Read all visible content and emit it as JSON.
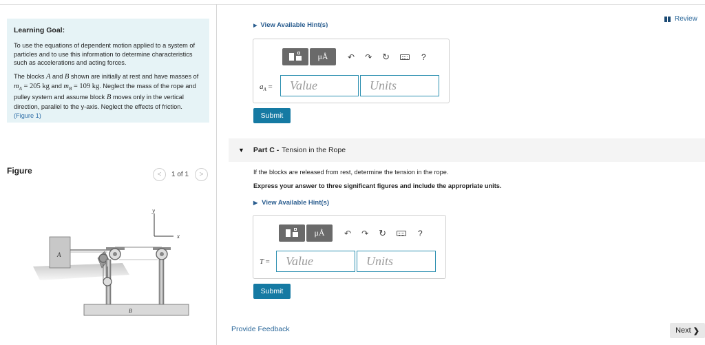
{
  "learning_goal": {
    "title": "Learning Goal:",
    "intro": "To use the equations of dependent motion applied to a system of particles and to use this information to determine characteristics such as accelerations and acting forces.",
    "p_lead": "The blocks",
    "p_A": "A",
    "p_and": "and",
    "p_B": "B",
    "p_shown": "shown are initially at rest and have masses of",
    "p_mA": "m",
    "p_mA_sub": "A",
    "p_eq1": " = 205 kg",
    "p_and2": "and",
    "p_mB": "m",
    "p_mB_sub": "B",
    "p_eq2": " = 109 kg",
    "p_rest1": ". Neglect the mass of the rope and pulley system and assume block",
    "p_B2": "B",
    "p_rest2": "moves only in the vertical direction, parallel to the y-axis. Neglect the effects of friction.",
    "figure_link": "(Figure 1)"
  },
  "figure_panel": {
    "title": "Figure",
    "pager_text": "1 of 1",
    "labels": {
      "block_a": "A",
      "block_b": "B",
      "axis_y": "y",
      "axis_x": "x"
    }
  },
  "top": {
    "hint_cut": "View Available Hint(s)",
    "review": "Review"
  },
  "part_b": {
    "variable": "a",
    "variable_sub": "A",
    "variable_eq": "=",
    "value_placeholder": "Value",
    "units_placeholder": "Units",
    "submit": "Submit"
  },
  "part_c": {
    "label": "Part C -",
    "title": "Tension in the Rope",
    "question": "If the blocks are released from rest, determine the tension in the rope.",
    "instruction": "Express your answer to three significant figures and include the appropriate units.",
    "hint": "View Available Hint(s)",
    "variable": "T",
    "variable_eq": "=",
    "value_placeholder": "Value",
    "units_placeholder": "Units",
    "submit": "Submit"
  },
  "toolbar": {
    "mu_label": "μÅ",
    "undo": "↶",
    "redo": "↷",
    "reset": "↻",
    "help": "?"
  },
  "footer": {
    "feedback": "Provide Feedback",
    "next": "Next",
    "next_arrow": "❯"
  },
  "icons": [
    "template-icon",
    "units-icon",
    "undo-icon",
    "redo-icon",
    "reset-icon",
    "keyboard-icon",
    "help-icon",
    "caret-down-icon",
    "review-icon",
    "chevron-left-icon",
    "chevron-right-icon"
  ]
}
